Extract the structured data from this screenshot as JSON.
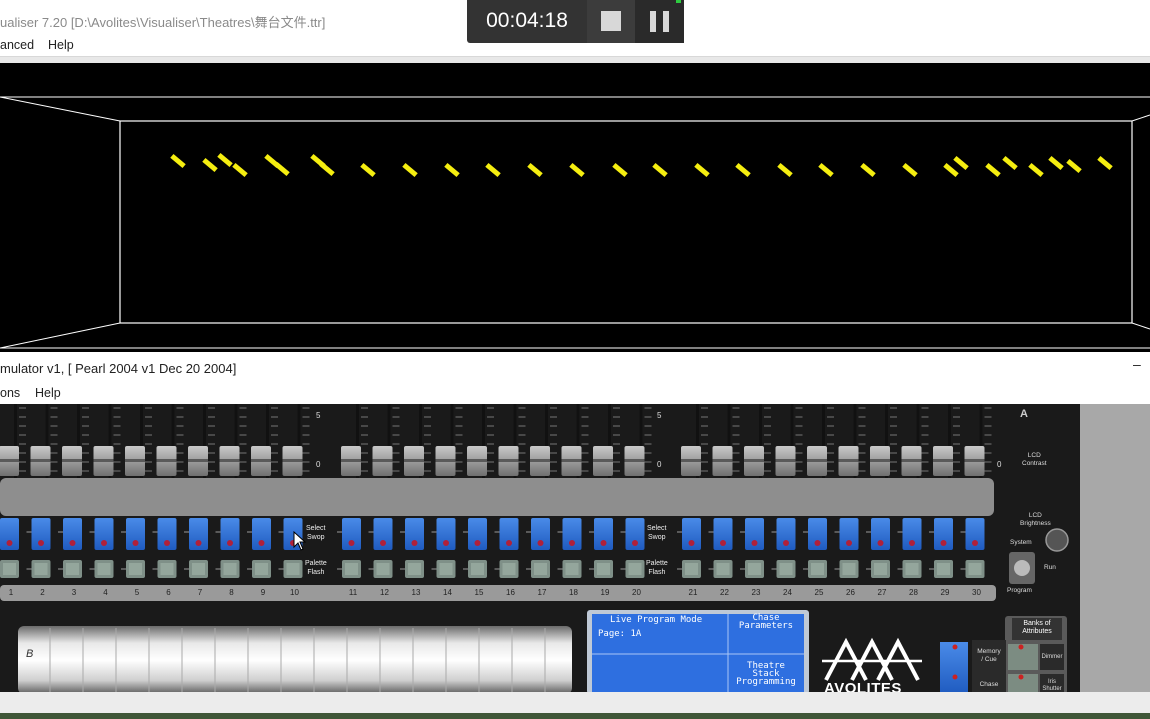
{
  "visualiser": {
    "title": "ualiser 7.20 [D:\\Avolites\\Visualiser\\Theatres\\舞台文件.ttr]",
    "menu": [
      "anced",
      "Help"
    ]
  },
  "recorder": {
    "time": "00:04:18",
    "stop_icon": "stop-icon",
    "pause_icon": "pause-icon"
  },
  "simulator": {
    "title": "mulator v1, [ Pearl 2004 v1  Dec 20 2004]",
    "menu": [
      "ons",
      "Help"
    ],
    "minimize": "–",
    "console": {
      "fader_scale_top": "5",
      "fader_scale_mid": "0",
      "fader_numbers": [
        "1",
        "2",
        "3",
        "4",
        "5",
        "6",
        "7",
        "8",
        "9",
        "10",
        "11",
        "12",
        "13",
        "14",
        "15",
        "16",
        "17",
        "18",
        "19",
        "20",
        "21",
        "22",
        "23",
        "24",
        "25",
        "26",
        "27",
        "28",
        "29",
        "30"
      ],
      "swop_label": [
        "Select",
        "Swop"
      ],
      "flash_label": [
        "Palette",
        "Flash"
      ],
      "scale_a": "A",
      "lcd_contrast": [
        "LCD",
        "Contrast"
      ],
      "lcd_brightness": [
        "LCD",
        "Brightness"
      ],
      "system_label": "System",
      "run_label": "Run",
      "program_label": "Program",
      "lcd_lines": [
        "Live Program Mode",
        "Page: 1A"
      ],
      "lcd_right_top": [
        "Chase",
        "Parameters"
      ],
      "lcd_right_bottom": [
        "Theatre",
        "Stack",
        "Programming"
      ],
      "logo_text": "AVOLITES",
      "wheel_letter": "B",
      "banks_label": [
        "Banks of",
        "Attributes"
      ],
      "memory_cue_label": [
        "Memory",
        "/ Cue"
      ],
      "chase_label": "Chase",
      "dimmer_label": "Dimmer",
      "iris_label": [
        "Iris",
        "Shutter"
      ],
      "colors": {
        "blue_button": "#2f73d6",
        "lcd_bg": "#2e6fe0",
        "flash_button": "#8a9a90"
      }
    }
  },
  "visualiser_canvas": {
    "fixture_color": "#f5ee10"
  }
}
